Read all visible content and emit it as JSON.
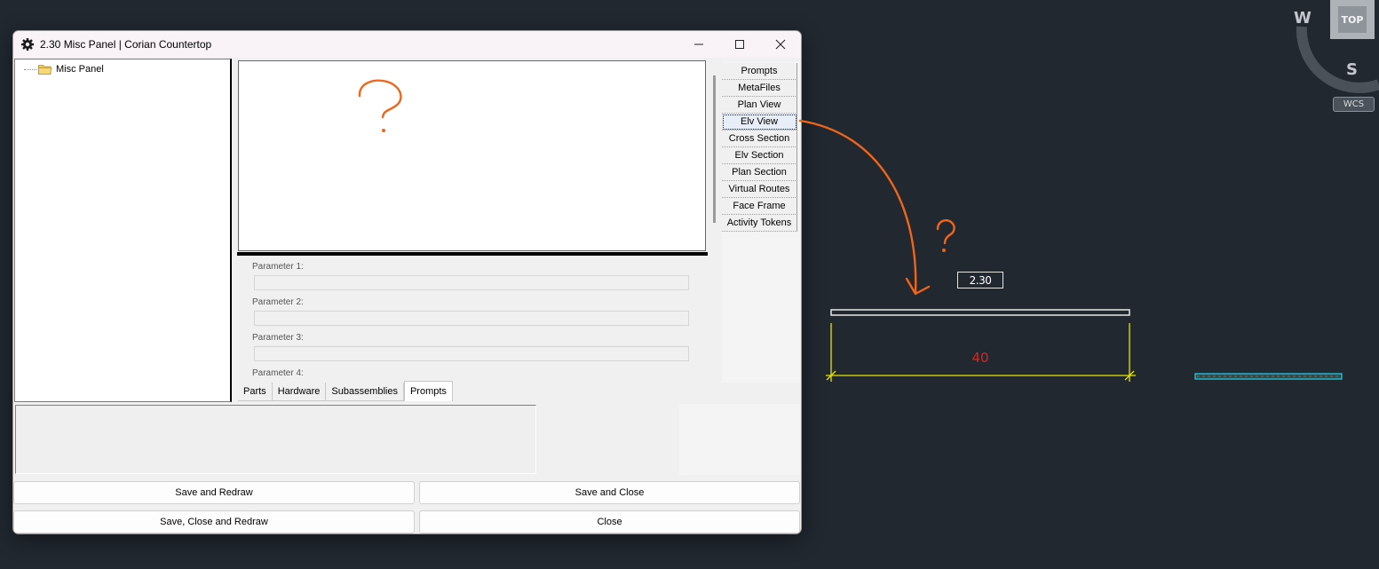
{
  "window": {
    "title": "2.30 Misc Panel | Corian Countertop",
    "icon": "gear-icon"
  },
  "tree": {
    "items": [
      {
        "label": "Misc Panel",
        "icon": "folder-icon"
      }
    ]
  },
  "side_buttons": [
    "Prompts",
    "MetaFiles",
    "Plan View",
    "Elv View",
    "Cross Section",
    "Elv Section",
    "Plan Section",
    "Virtual Routes",
    "Face Frame",
    "Activity Tokens"
  ],
  "focused_side_button": "Elv View",
  "parameters": [
    {
      "label": "Parameter 1:",
      "value": ""
    },
    {
      "label": "Parameter 2:",
      "value": ""
    },
    {
      "label": "Parameter 3:",
      "value": ""
    },
    {
      "label": "Parameter 4:",
      "value": ""
    }
  ],
  "tabs": [
    "Parts",
    "Hardware",
    "Subassemblies",
    "Prompts"
  ],
  "active_tab": "Prompts",
  "buttons": {
    "save_redraw": "Save and Redraw",
    "save_close": "Save and Close",
    "save_close_redraw": "Save, Close and Redraw",
    "close": "Close"
  },
  "viewcube": {
    "top_face": "TOP",
    "west": "W",
    "south": "S",
    "wcs": "WCS"
  },
  "cad": {
    "label_text": "2.30",
    "dimension_text": "40"
  },
  "annotations": {
    "question_mark": "?"
  },
  "colors": {
    "canvas_bg": "#212830",
    "annotation_orange": "#f0651a",
    "dimension_yellow": "#e6e600",
    "dimension_text_red": "#d02828",
    "panel_cyan": "#22c8e0"
  }
}
